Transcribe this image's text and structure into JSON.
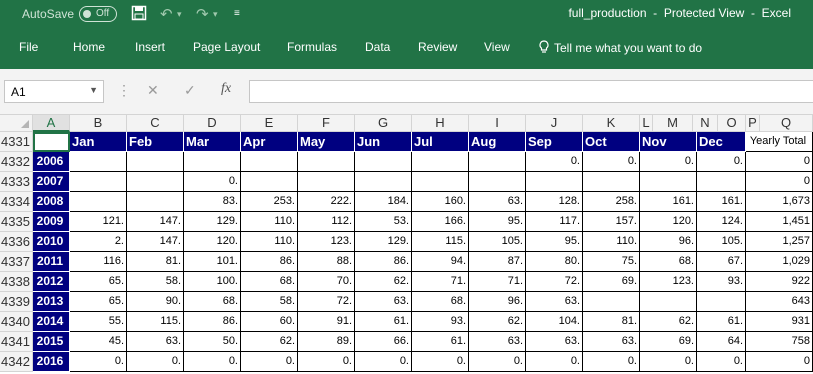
{
  "titlebar": {
    "autosave_label": "AutoSave",
    "autosave_state": "Off",
    "title": "full_production  -  Protected View  -  Excel"
  },
  "ribbon": {
    "tabs": [
      "File",
      "Home",
      "Insert",
      "Page Layout",
      "Formulas",
      "Data",
      "Review",
      "View"
    ],
    "tell_me": "Tell me what you want to do"
  },
  "formula_bar": {
    "name_box": "A1",
    "formula": ""
  },
  "sheet": {
    "columns": [
      "A",
      "B",
      "C",
      "D",
      "E",
      "F",
      "G",
      "H",
      "I",
      "J",
      "K",
      "L",
      "M",
      "N",
      "O",
      "P",
      "Q"
    ],
    "selected_column": "A",
    "header_labels": [
      "Jan",
      "Feb",
      "Mar",
      "Apr",
      "May",
      "Jun",
      "Jul",
      "Aug",
      "Sep",
      "Oct",
      "Nov",
      "Dec",
      "Yearly Total"
    ],
    "rows": [
      {
        "num": "4331",
        "year": "",
        "vals": [
          "Jan",
          "Feb",
          "Mar",
          "Apr",
          "May",
          "Jun",
          "Jul",
          "Aug",
          "Sep",
          "Oct",
          "Nov",
          "Dec"
        ],
        "total": "Yearly Total",
        "header": true
      },
      {
        "num": "4332",
        "year": "2006",
        "vals": [
          "",
          "",
          "",
          "",
          "",
          "",
          "",
          "",
          "0.",
          "0.",
          "0.",
          "0."
        ],
        "total": "0"
      },
      {
        "num": "4333",
        "year": "2007",
        "vals": [
          "",
          "",
          "0.",
          "",
          "",
          "",
          "",
          "",
          "",
          "",
          "",
          ""
        ],
        "total": "0"
      },
      {
        "num": "4334",
        "year": "2008",
        "vals": [
          "",
          "",
          "83.",
          "253.",
          "222.",
          "184.",
          "160.",
          "63.",
          "128.",
          "258.",
          "161.",
          "161."
        ],
        "total": "1,673"
      },
      {
        "num": "4335",
        "year": "2009",
        "vals": [
          "121.",
          "147.",
          "129.",
          "110.",
          "112.",
          "53.",
          "166.",
          "95.",
          "117.",
          "157.",
          "120.",
          "124."
        ],
        "total": "1,451"
      },
      {
        "num": "4336",
        "year": "2010",
        "vals": [
          "2.",
          "147.",
          "120.",
          "110.",
          "123.",
          "129.",
          "115.",
          "105.",
          "95.",
          "110.",
          "96.",
          "105."
        ],
        "total": "1,257"
      },
      {
        "num": "4337",
        "year": "2011",
        "vals": [
          "116.",
          "81.",
          "101.",
          "86.",
          "88.",
          "86.",
          "94.",
          "87.",
          "80.",
          "75.",
          "68.",
          "67."
        ],
        "total": "1,029"
      },
      {
        "num": "4338",
        "year": "2012",
        "vals": [
          "65.",
          "58.",
          "100.",
          "68.",
          "70.",
          "62.",
          "71.",
          "71.",
          "72.",
          "69.",
          "123.",
          "93."
        ],
        "total": "922"
      },
      {
        "num": "4339",
        "year": "2013",
        "vals": [
          "65.",
          "90.",
          "68.",
          "58.",
          "72.",
          "63.",
          "68.",
          "96.",
          "63.",
          "",
          "",
          ""
        ],
        "total": "643"
      },
      {
        "num": "4340",
        "year": "2014",
        "vals": [
          "55.",
          "115.",
          "86.",
          "60.",
          "91.",
          "61.",
          "93.",
          "62.",
          "104.",
          "81.",
          "62.",
          "61."
        ],
        "total": "931"
      },
      {
        "num": "4341",
        "year": "2015",
        "vals": [
          "45.",
          "63.",
          "50.",
          "62.",
          "89.",
          "66.",
          "61.",
          "63.",
          "63.",
          "63.",
          "69.",
          "64."
        ],
        "total": "758"
      },
      {
        "num": "4342",
        "year": "2016",
        "vals": [
          "0.",
          "0.",
          "0.",
          "0.",
          "0.",
          "0.",
          "0.",
          "0.",
          "0.",
          "0.",
          "0.",
          "0."
        ],
        "total": "0"
      }
    ]
  },
  "colors": {
    "excel_green": "#217346",
    "header_blue": "#000080"
  }
}
